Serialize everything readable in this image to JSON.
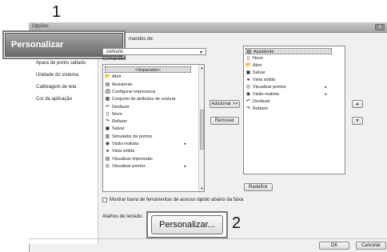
{
  "window": {
    "title": "Opções",
    "close_label": "x"
  },
  "nav": {
    "selected_label": "Personalizar",
    "items": [
      "Apara de ponto saltado",
      "Unidade do sistema",
      "Calibragem de tela",
      "Cor da aplicação"
    ]
  },
  "steps": {
    "one": "1",
    "two": "2"
  },
  "choose_commands": {
    "label": "mandos de:",
    "value": "comuns"
  },
  "commands_label": "Comandos:",
  "commands_list": [
    {
      "icon": "",
      "label": "<Separador>"
    },
    {
      "icon": "open-icon",
      "label": "Abrir"
    },
    {
      "icon": "assistant-icon",
      "label": "Assistente"
    },
    {
      "icon": "printer-icon",
      "label": "Configurar impressora"
    },
    {
      "icon": "stitch-set-icon",
      "label": "Conjunto de atributos de costura"
    },
    {
      "icon": "undo-icon",
      "label": "Desfazer"
    },
    {
      "icon": "new-icon",
      "label": "Novo"
    },
    {
      "icon": "redo-icon",
      "label": "Refazer"
    },
    {
      "icon": "save-icon",
      "label": "Salvar"
    },
    {
      "icon": "simulator-icon",
      "label": "Simulador de pontos"
    },
    {
      "icon": "realistic-view-icon",
      "label": "Visão realista",
      "submenu": true
    },
    {
      "icon": "solid-view-icon",
      "label": "Vista sólida"
    },
    {
      "icon": "print-preview-icon",
      "label": "Visualizar impressão"
    },
    {
      "icon": "view-stitches-icon",
      "label": "Visualizar pontos",
      "submenu": true
    }
  ],
  "toolbar_list": [
    {
      "icon": "assistant-icon",
      "label": "Assistente"
    },
    {
      "icon": "new-icon",
      "label": "Novo"
    },
    {
      "icon": "open-icon",
      "label": "Abrir"
    },
    {
      "icon": "save-icon",
      "label": "Salvar"
    },
    {
      "icon": "solid-view-icon",
      "label": "Vista sólida"
    },
    {
      "icon": "view-stitches-icon",
      "label": "Visualizar pontos",
      "submenu": true
    },
    {
      "icon": "realistic-view-icon",
      "label": "Visão realista",
      "submenu": true
    },
    {
      "icon": "undo-icon",
      "label": "Desfazer"
    },
    {
      "icon": "redo-icon",
      "label": "Refazer"
    }
  ],
  "buttons": {
    "add": "Adicionar >>",
    "remove": "Remover",
    "move_up": "▲",
    "move_down": "▼",
    "reset": "Redefinir",
    "customize": "Personalizar...",
    "ok": "OK",
    "cancel": "Cancelar"
  },
  "checkbox_label": "Mostrar barra de ferramentas de acesso rápido abaixo da faixa",
  "shortcuts_label": "Atalhos de teclado:"
}
